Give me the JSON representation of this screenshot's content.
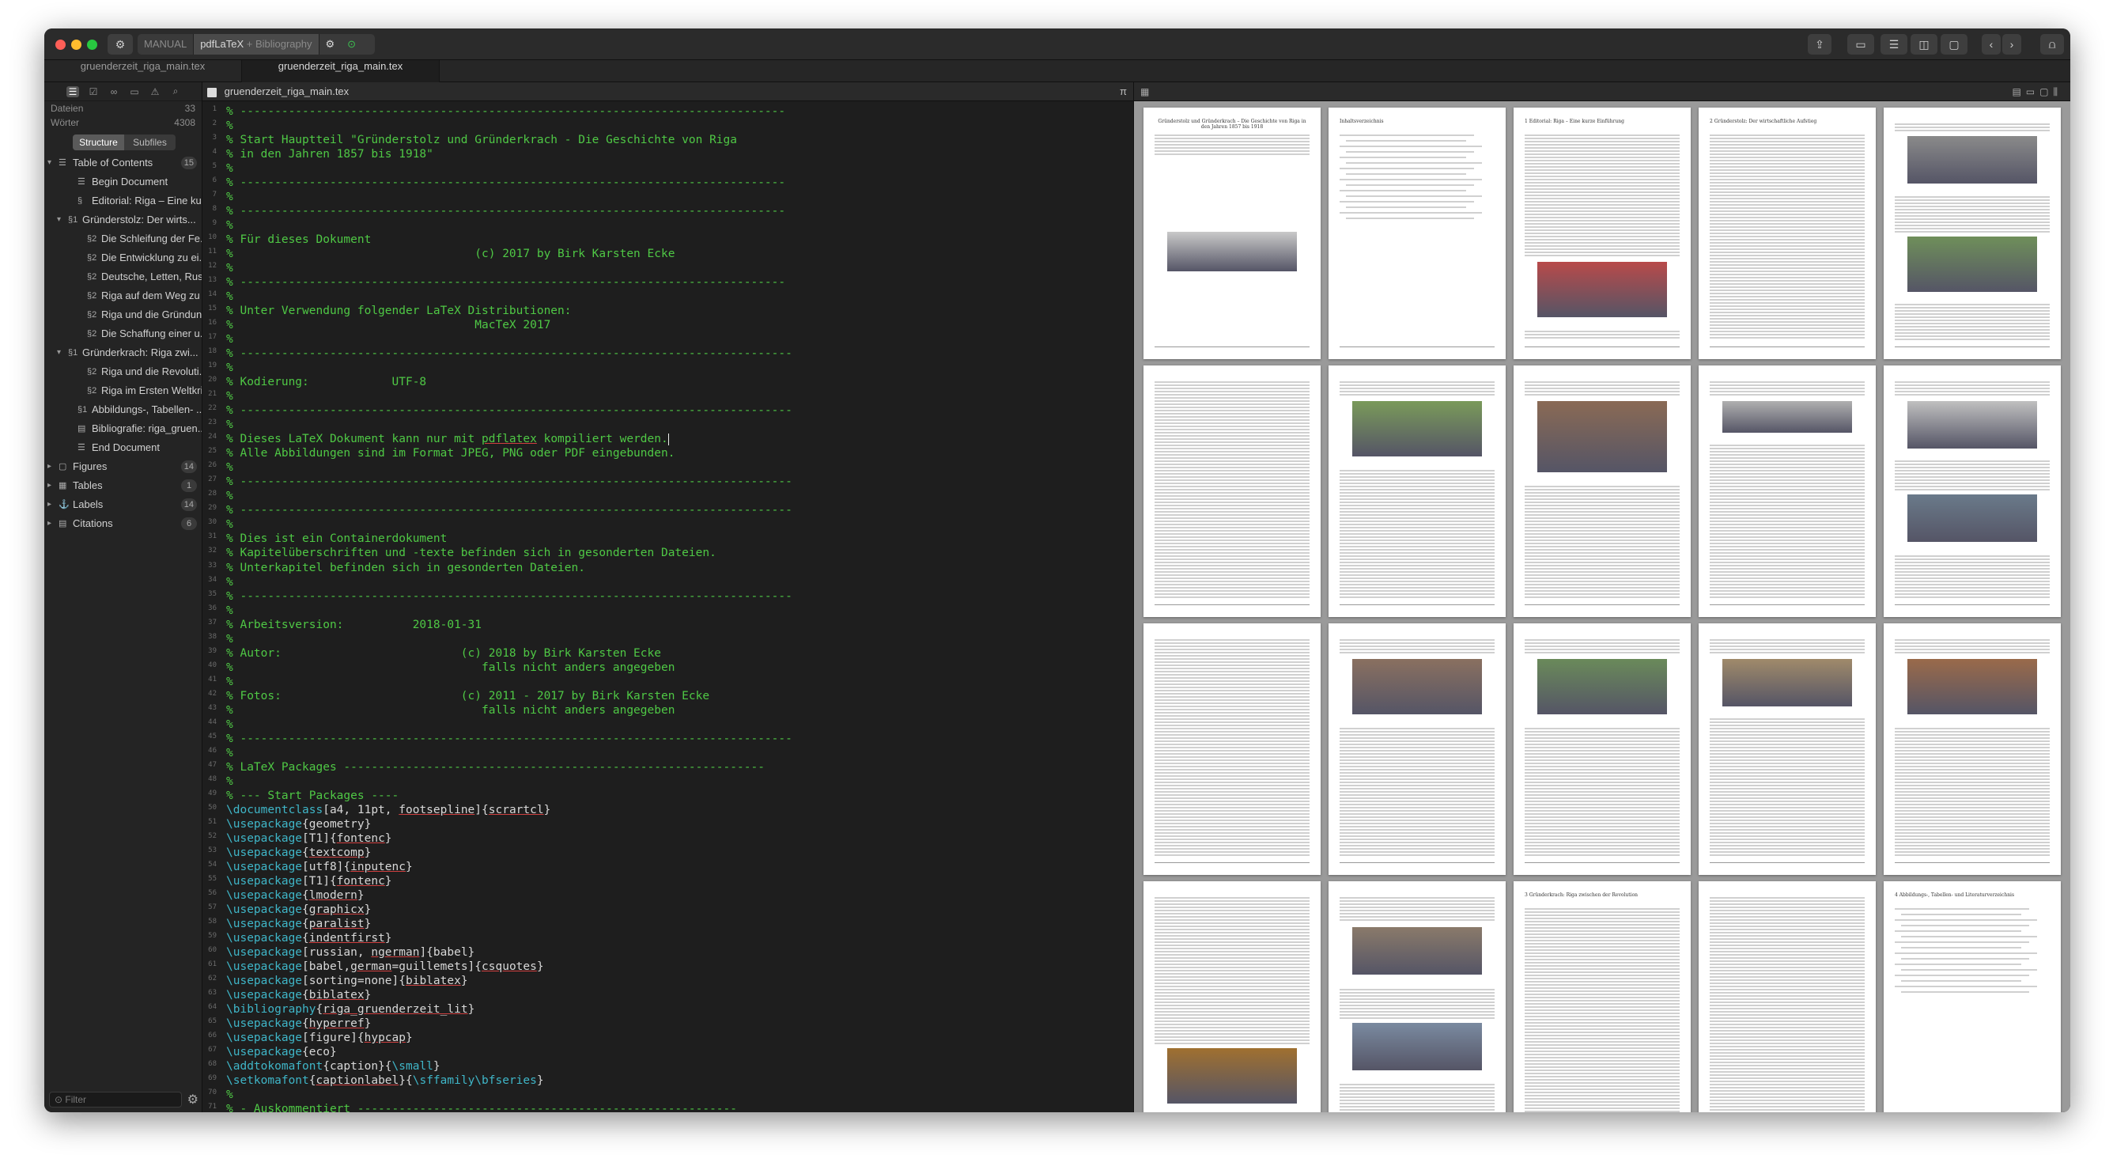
{
  "titlebar": {
    "compile_mode": "MANUAL",
    "engine": "pdfLaTeX",
    "engine_plus": "+ Bibliography"
  },
  "tabs": [
    {
      "label": "gruenderzeit_riga_main.tex",
      "active": false
    },
    {
      "label": "gruenderzeit_riga_main.tex",
      "active": true
    }
  ],
  "sidebar": {
    "stats": [
      {
        "label": "Dateien",
        "value": "33"
      },
      {
        "label": "Wörter",
        "value": "4308"
      }
    ],
    "tabs": [
      "Structure",
      "Subfiles"
    ],
    "tree": [
      {
        "label": "Table of Contents",
        "count": "15",
        "indent": 0,
        "tri": "▾",
        "icon": "☰"
      },
      {
        "label": "Begin Document",
        "indent": 2,
        "icon": "☰"
      },
      {
        "label": "Editorial: Riga – Eine kur...",
        "indent": 2,
        "icon": "§"
      },
      {
        "label": "Gründerstolz: Der wirts...",
        "indent": 1,
        "tri": "▾",
        "icon": "§1"
      },
      {
        "label": "Die Schleifung der Fe...",
        "indent": 3,
        "icon": "§2"
      },
      {
        "label": "Die Entwicklung zu ei...",
        "indent": 3,
        "icon": "§2"
      },
      {
        "label": "Deutsche, Letten, Rus...",
        "indent": 3,
        "icon": "§2"
      },
      {
        "label": "Riga auf dem Weg zu ...",
        "indent": 3,
        "icon": "§2"
      },
      {
        "label": "Riga und die Gründun...",
        "indent": 3,
        "icon": "§2"
      },
      {
        "label": "Die Schaffung einer u...",
        "indent": 3,
        "icon": "§2"
      },
      {
        "label": "Gründerkrach: Riga zwi...",
        "indent": 1,
        "tri": "▾",
        "icon": "§1"
      },
      {
        "label": "Riga und die Revoluti...",
        "indent": 3,
        "icon": "§2"
      },
      {
        "label": "Riga im Ersten Weltkri...",
        "indent": 3,
        "icon": "§2"
      },
      {
        "label": "Abbildungs-, Tabellen- ...",
        "indent": 2,
        "icon": "§1"
      },
      {
        "label": "Bibliografie: riga_gruen...",
        "indent": 2,
        "icon": "▤"
      },
      {
        "label": "End Document",
        "indent": 2,
        "icon": "☰"
      },
      {
        "label": "Figures",
        "count": "14",
        "indent": 0,
        "tri": "▸",
        "icon": "▢"
      },
      {
        "label": "Tables",
        "count": "1",
        "indent": 0,
        "tri": "▸",
        "icon": "▦"
      },
      {
        "label": "Labels",
        "count": "14",
        "indent": 0,
        "tri": "▸",
        "icon": "⚓"
      },
      {
        "label": "Citations",
        "count": "6",
        "indent": 0,
        "tri": "▸",
        "icon": "▤"
      }
    ],
    "filter_placeholder": "Filter"
  },
  "editor": {
    "filename": "gruenderzeit_riga_main.tex",
    "pi_symbol": "π",
    "lines": [
      [
        [
          "cmt",
          "% -------------------------------------------------------------------------------"
        ]
      ],
      [
        [
          "cmt",
          "%"
        ]
      ],
      [
        [
          "cmt",
          "% Start Hauptteil \"Gründerstolz und Gründerkrach - Die Geschichte von Riga"
        ]
      ],
      [
        [
          "cmt",
          "% in den Jahren 1857 bis 1918\""
        ]
      ],
      [
        [
          "cmt",
          "%"
        ]
      ],
      [
        [
          "cmt",
          "% -------------------------------------------------------------------------------"
        ]
      ],
      [
        [
          "cmt",
          "%"
        ]
      ],
      [
        [
          "cmt",
          "% -------------------------------------------------------------------------------"
        ]
      ],
      [
        [
          "cmt",
          "%"
        ]
      ],
      [
        [
          "cmt",
          "% Für dieses Dokument"
        ]
      ],
      [
        [
          "cmt",
          "%                                   (c) 2017 by Birk Karsten Ecke"
        ]
      ],
      [
        [
          "cmt",
          "%"
        ]
      ],
      [
        [
          "cmt",
          "% -------------------------------------------------------------------------------"
        ]
      ],
      [
        [
          "cmt",
          "%"
        ]
      ],
      [
        [
          "cmt",
          "% Unter Verwendung folgender LaTeX Distributionen:"
        ]
      ],
      [
        [
          "cmt",
          "%                                   MacTeX 2017"
        ]
      ],
      [
        [
          "cmt",
          "%"
        ]
      ],
      [
        [
          "cmt",
          "% --------------------------------------------------------------------------------"
        ]
      ],
      [
        [
          "cmt",
          "%"
        ]
      ],
      [
        [
          "cmt",
          "% Kodierung:            UTF-8"
        ]
      ],
      [
        [
          "cmt",
          "%"
        ]
      ],
      [
        [
          "cmt",
          "% --------------------------------------------------------------------------------"
        ]
      ],
      [
        [
          "cmt",
          "%"
        ]
      ],
      [
        [
          "cmt",
          "% Dieses LaTeX Dokument kann nur mit "
        ],
        [
          "cmt ul",
          "pdflatex"
        ],
        [
          "cmt",
          " kompiliert werden."
        ],
        [
          "caret",
          ""
        ]
      ],
      [
        [
          "cmt",
          "% Alle Abbildungen sind im Format JPEG, PNG oder PDF eingebunden."
        ]
      ],
      [
        [
          "cmt",
          "%"
        ]
      ],
      [
        [
          "cmt",
          "% --------------------------------------------------------------------------------"
        ]
      ],
      [
        [
          "cmt",
          "%"
        ]
      ],
      [
        [
          "cmt",
          "% --------------------------------------------------------------------------------"
        ]
      ],
      [
        [
          "cmt",
          "%"
        ]
      ],
      [
        [
          "cmt",
          "% Dies ist ein Containerdokument"
        ]
      ],
      [
        [
          "cmt",
          "% Kapitelüberschriften und -texte befinden sich in gesonderten Dateien."
        ]
      ],
      [
        [
          "cmt",
          "% Unterkapitel befinden sich in gesonderten Dateien."
        ]
      ],
      [
        [
          "cmt",
          "%"
        ]
      ],
      [
        [
          "cmt",
          "% --------------------------------------------------------------------------------"
        ]
      ],
      [
        [
          "cmt",
          "%"
        ]
      ],
      [
        [
          "cmt",
          "% Arbeitsversion:          2018-01-31"
        ]
      ],
      [
        [
          "cmt",
          "%"
        ]
      ],
      [
        [
          "cmt",
          "% Autor:                          (c) 2018 by Birk Karsten Ecke"
        ]
      ],
      [
        [
          "cmt",
          "%                                    falls nicht anders angegeben"
        ]
      ],
      [
        [
          "cmt",
          "%"
        ]
      ],
      [
        [
          "cmt",
          "% Fotos:                          (c) 2011 - 2017 by Birk Karsten Ecke"
        ]
      ],
      [
        [
          "cmt",
          "%                                    falls nicht anders angegeben"
        ]
      ],
      [
        [
          "cmt",
          "%"
        ]
      ],
      [
        [
          "cmt",
          "% --------------------------------------------------------------------------------"
        ]
      ],
      [
        [
          "cmt",
          "%"
        ]
      ],
      [
        [
          "cmt",
          "% LaTeX Packages -------------------------------------------------------------"
        ]
      ],
      [
        [
          "cmt",
          "%"
        ]
      ],
      [
        [
          "cmt",
          "% --- Start Packages ----"
        ]
      ],
      [
        [
          "cmd",
          "\\documentclass"
        ],
        [
          "arg",
          "[a4, 11pt, "
        ],
        [
          "arg ul",
          "footsepline"
        ],
        [
          "arg",
          "]{"
        ],
        [
          "arg ul",
          "scrartcl"
        ],
        [
          "arg",
          "}"
        ]
      ],
      [
        [
          "cmd",
          "\\usepackage"
        ],
        [
          "arg",
          "{geometry}"
        ]
      ],
      [
        [
          "cmd",
          "\\usepackage"
        ],
        [
          "arg",
          "[T1]{"
        ],
        [
          "arg ul",
          "fontenc"
        ],
        [
          "arg",
          "}"
        ]
      ],
      [
        [
          "cmd",
          "\\usepackage"
        ],
        [
          "arg",
          "{"
        ],
        [
          "arg ul",
          "textcomp"
        ],
        [
          "arg",
          "}"
        ]
      ],
      [
        [
          "cmd",
          "\\usepackage"
        ],
        [
          "arg",
          "[utf8]{"
        ],
        [
          "arg ul",
          "inputenc"
        ],
        [
          "arg",
          "}"
        ]
      ],
      [
        [
          "cmd",
          "\\usepackage"
        ],
        [
          "arg",
          "[T1]{"
        ],
        [
          "arg ul",
          "fontenc"
        ],
        [
          "arg",
          "}"
        ]
      ],
      [
        [
          "cmd",
          "\\usepackage"
        ],
        [
          "arg",
          "{"
        ],
        [
          "arg ul",
          "lmodern"
        ],
        [
          "arg",
          "}"
        ]
      ],
      [
        [
          "cmd",
          "\\usepackage"
        ],
        [
          "arg",
          "{"
        ],
        [
          "arg ul",
          "graphicx"
        ],
        [
          "arg",
          "}"
        ]
      ],
      [
        [
          "cmd",
          "\\usepackage"
        ],
        [
          "arg",
          "{"
        ],
        [
          "arg ul",
          "paralist"
        ],
        [
          "arg",
          "}"
        ]
      ],
      [
        [
          "cmd",
          "\\usepackage"
        ],
        [
          "arg",
          "{"
        ],
        [
          "arg ul",
          "indentfirst"
        ],
        [
          "arg",
          "}"
        ]
      ],
      [
        [
          "cmd",
          "\\usepackage"
        ],
        [
          "arg",
          "[russian, "
        ],
        [
          "arg ul",
          "ngerman"
        ],
        [
          "arg",
          "]{babel}"
        ]
      ],
      [
        [
          "cmd",
          "\\usepackage"
        ],
        [
          "arg",
          "[babel,"
        ],
        [
          "arg ul",
          "german"
        ],
        [
          "arg",
          "=guillemets]{"
        ],
        [
          "arg ul",
          "csquotes"
        ],
        [
          "arg",
          "}"
        ]
      ],
      [
        [
          "cmd",
          "\\usepackage"
        ],
        [
          "arg",
          "[sorting=none]{"
        ],
        [
          "arg ul",
          "biblatex"
        ],
        [
          "arg",
          "}"
        ]
      ],
      [
        [
          "cmd",
          "\\usepackage"
        ],
        [
          "arg",
          "{"
        ],
        [
          "arg ul",
          "biblatex"
        ],
        [
          "arg",
          "}"
        ]
      ],
      [
        [
          "cmd",
          "\\bibliography"
        ],
        [
          "arg",
          "{"
        ],
        [
          "arg ul",
          "riga_gruenderzeit_lit"
        ],
        [
          "arg",
          "}"
        ]
      ],
      [
        [
          "cmd",
          "\\usepackage"
        ],
        [
          "arg",
          "{"
        ],
        [
          "arg ul",
          "hyperref"
        ],
        [
          "arg",
          "}"
        ]
      ],
      [
        [
          "cmd",
          "\\usepackage"
        ],
        [
          "arg",
          "[figure]{"
        ],
        [
          "arg ul",
          "hypcap"
        ],
        [
          "arg",
          "}"
        ]
      ],
      [
        [
          "cmd",
          "\\usepackage"
        ],
        [
          "arg",
          "{eco}"
        ]
      ],
      [
        [
          "cmd",
          "\\addtokomafont"
        ],
        [
          "arg",
          "{caption}{"
        ],
        [
          "cmd",
          "\\small"
        ],
        [
          "arg",
          "}"
        ]
      ],
      [
        [
          "cmd",
          "\\setkomafont"
        ],
        [
          "arg",
          "{"
        ],
        [
          "arg ul",
          "captionlabel"
        ],
        [
          "arg",
          "}{"
        ],
        [
          "cmd",
          "\\sffamily\\bfseries"
        ],
        [
          "arg",
          "}"
        ]
      ],
      [
        [
          "cmt",
          "%"
        ]
      ],
      [
        [
          "cmt",
          "% - Auskommentiert -------------------------------------------------------"
        ]
      ]
    ]
  },
  "preview": {
    "pages": [
      {
        "type": "title",
        "title": "Gründerstolz und Gründerkrach – Die Geschichte von Riga in den Jahren 1857 bis 1918",
        "imgs": [
          {
            "h": 50,
            "c": "#c9c9c9",
            "t": 0.43
          }
        ]
      },
      {
        "type": "toc",
        "title": "Inhaltsverzeichnis"
      },
      {
        "type": "text",
        "title": "1 Editorial: Riga – Eine kurze Einführung",
        "imgs": [
          {
            "h": 70,
            "c": "#b84a4a",
            "t": 0.55
          }
        ]
      },
      {
        "type": "text",
        "title": "2 Gründerstolz: Der wirtschaftliche Aufstieg",
        "imgs": []
      },
      {
        "type": "text",
        "title": "",
        "imgs": [
          {
            "h": 60,
            "c": "#8a8a8a",
            "t": 0.05
          },
          {
            "h": 70,
            "c": "#6f8f5a",
            "t": 0.45
          }
        ]
      },
      {
        "type": "text",
        "title": "",
        "imgs": []
      },
      {
        "type": "text",
        "title": "",
        "imgs": [
          {
            "h": 70,
            "c": "#7a9a5a",
            "t": 0.08
          }
        ]
      },
      {
        "type": "text",
        "title": "",
        "imgs": [
          {
            "h": 90,
            "c": "#8a6a55",
            "t": 0.08
          }
        ]
      },
      {
        "type": "text",
        "title": "",
        "imgs": [
          {
            "h": 40,
            "c": "#b0b0b0",
            "t": 0.08
          }
        ]
      },
      {
        "type": "text",
        "title": "",
        "imgs": [
          {
            "h": 60,
            "c": "#c0c0c0",
            "t": 0.08
          },
          {
            "h": 60,
            "c": "#6a7a8a",
            "t": 0.45
          }
        ]
      },
      {
        "type": "text",
        "title": "",
        "imgs": []
      },
      {
        "type": "text",
        "title": "",
        "imgs": [
          {
            "h": 70,
            "c": "#8a7060",
            "t": 0.08
          }
        ]
      },
      {
        "type": "text",
        "title": "",
        "imgs": [
          {
            "h": 70,
            "c": "#6a8a5a",
            "t": 0.08
          }
        ]
      },
      {
        "type": "text",
        "title": "",
        "imgs": [
          {
            "h": 60,
            "c": "#a08a6a",
            "t": 0.08
          }
        ]
      },
      {
        "type": "text",
        "title": "",
        "imgs": [
          {
            "h": 70,
            "c": "#9a6a4a",
            "t": 0.08
          }
        ]
      },
      {
        "type": "text",
        "title": "",
        "imgs": [
          {
            "h": 70,
            "c": "#a07030",
            "t": 0.6
          }
        ]
      },
      {
        "type": "text",
        "title": "",
        "imgs": [
          {
            "h": 60,
            "c": "#8a7a6a",
            "t": 0.12
          },
          {
            "h": 60,
            "c": "#7a8aa0",
            "t": 0.5
          }
        ]
      },
      {
        "type": "text",
        "title": "3 Gründerkrach: Riga zwischen der Revolution",
        "imgs": []
      },
      {
        "type": "text",
        "title": "",
        "imgs": []
      },
      {
        "type": "toc",
        "title": "4 Abbildungs-, Tabellen- und Literaturverzeichnis"
      }
    ]
  }
}
